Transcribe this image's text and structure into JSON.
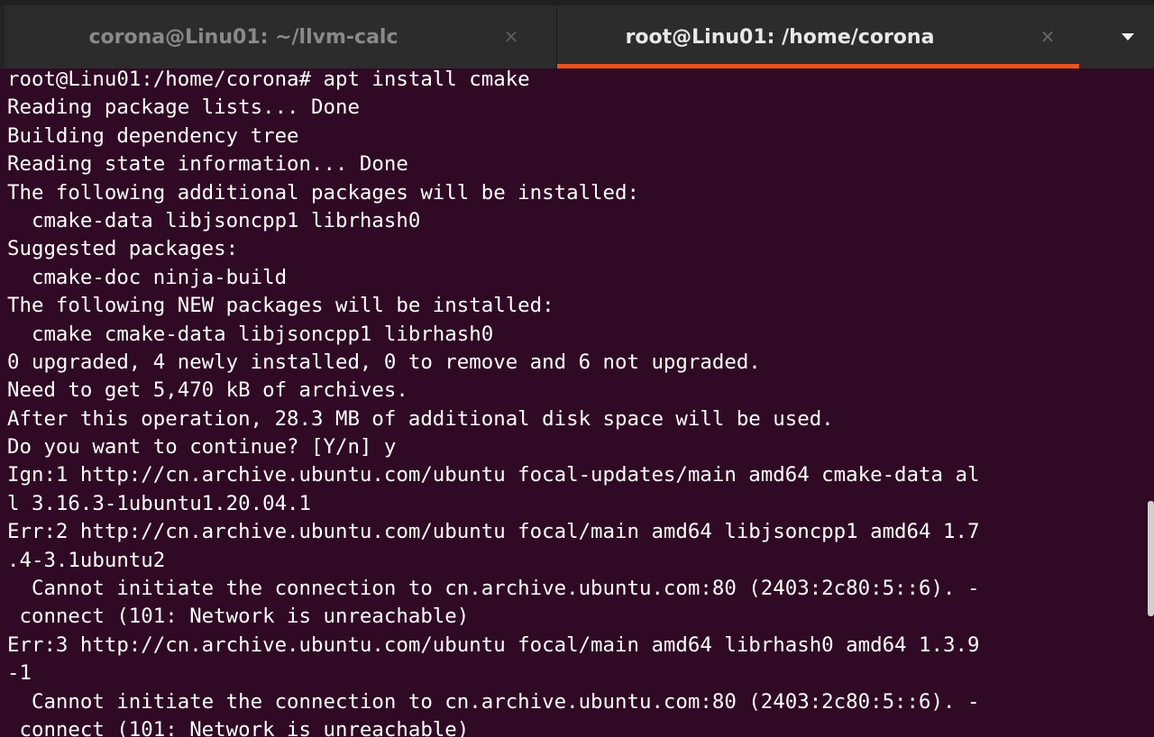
{
  "tabs": [
    {
      "title": "corona@Linu01: ~/llvm-calc",
      "active": false,
      "close_glyph": "×"
    },
    {
      "title": "root@Linu01: /home/corona",
      "active": true,
      "close_glyph": "×"
    }
  ],
  "tab_menu_icon": "chevron-down-icon",
  "colors": {
    "terminal_background": "#300a24",
    "terminal_text": "#ffffff",
    "tabbar_background": "#2c2c2c",
    "active_tab_indicator": "#e95420"
  },
  "terminal": {
    "lines": [
      "root@Linu01:/home/corona# apt install cmake",
      "Reading package lists... Done",
      "Building dependency tree",
      "Reading state information... Done",
      "The following additional packages will be installed:",
      "  cmake-data libjsoncpp1 librhash0",
      "Suggested packages:",
      "  cmake-doc ninja-build",
      "The following NEW packages will be installed:",
      "  cmake cmake-data libjsoncpp1 librhash0",
      "0 upgraded, 4 newly installed, 0 to remove and 6 not upgraded.",
      "Need to get 5,470 kB of archives.",
      "After this operation, 28.3 MB of additional disk space will be used.",
      "Do you want to continue? [Y/n] y",
      "Ign:1 http://cn.archive.ubuntu.com/ubuntu focal-updates/main amd64 cmake-data al",
      "l 3.16.3-1ubuntu1.20.04.1",
      "Err:2 http://cn.archive.ubuntu.com/ubuntu focal/main amd64 libjsoncpp1 amd64 1.7",
      ".4-3.1ubuntu2",
      "  Cannot initiate the connection to cn.archive.ubuntu.com:80 (2403:2c80:5::6). -",
      " connect (101: Network is unreachable)",
      "Err:3 http://cn.archive.ubuntu.com/ubuntu focal/main amd64 librhash0 amd64 1.3.9",
      "-1",
      "  Cannot initiate the connection to cn.archive.ubuntu.com:80 (2403:2c80:5::6). -",
      " connect (101: Network is unreachable)"
    ]
  }
}
